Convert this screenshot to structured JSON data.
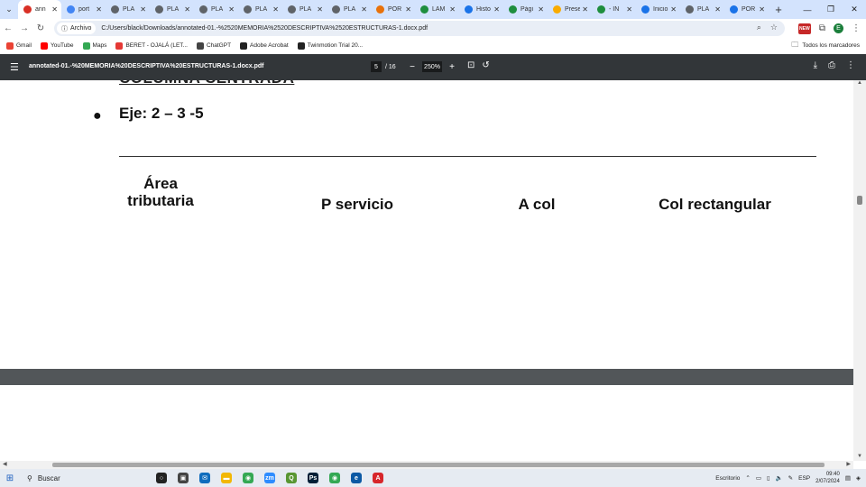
{
  "browser": {
    "tabs": [
      {
        "label": "ann",
        "active": true,
        "color": "#d93025",
        "icon": "pdf-icon"
      },
      {
        "label": "port",
        "color": "#4285f4",
        "icon": "google-icon"
      },
      {
        "label": "PLA",
        "color": "#5f6368",
        "icon": "globe-icon"
      },
      {
        "label": "PLA",
        "color": "#5f6368",
        "icon": "globe-icon"
      },
      {
        "label": "PLA",
        "color": "#5f6368",
        "icon": "globe-icon"
      },
      {
        "label": "PLA",
        "color": "#5f6368",
        "icon": "globe-icon"
      },
      {
        "label": "PLA",
        "color": "#5f6368",
        "icon": "globe-icon"
      },
      {
        "label": "PLA",
        "color": "#5f6368",
        "icon": "globe-icon"
      },
      {
        "label": "POR",
        "color": "#e8710a",
        "icon": "pdf-icon"
      },
      {
        "label": "LAM",
        "color": "#1e8e3e",
        "icon": "drive-icon"
      },
      {
        "label": "Histo",
        "color": "#1a73e8",
        "icon": "download-icon"
      },
      {
        "label": "Pági",
        "color": "#1e8e3e",
        "icon": "drive-icon"
      },
      {
        "label": "Prese",
        "color": "#f9ab00",
        "icon": "slides-icon"
      },
      {
        "label": "- IN",
        "color": "#1e8e3e",
        "icon": "drive-icon"
      },
      {
        "label": "Inicio",
        "color": "#1a73e8",
        "icon": "c-icon"
      },
      {
        "label": "PLA",
        "color": "#5f6368",
        "icon": "globe-icon"
      },
      {
        "label": "POR",
        "color": "#1a73e8",
        "icon": "doc-icon"
      }
    ],
    "new_tab": "+",
    "address": {
      "chip_label": "Archivo",
      "url": "C:/Users/black/Downloads/annotated-01.-%2520MEMORIA%2520DESCRIPTIVA%2520ESTRUCTURAS-1.docx.pdf"
    },
    "new_badge": "NEW",
    "profile_initial": "E",
    "bookmarks": [
      {
        "label": "Gmail",
        "color": "#ea4335"
      },
      {
        "label": "YouTube",
        "color": "#ff0000"
      },
      {
        "label": "Maps",
        "color": "#34a853"
      },
      {
        "label": "BERET - OJALÁ (LET...",
        "color": "#e53935"
      },
      {
        "label": "ChatGPT",
        "color": "#444444"
      },
      {
        "label": "Adobe Acrobat",
        "color": "#222222"
      },
      {
        "label": "Twinmotion Trial 20...",
        "color": "#222222"
      }
    ],
    "all_bookmarks": "Todos los marcadores"
  },
  "pdf_viewer": {
    "title": "annotated-01.-%20MEMORIA%20DESCRIPTIVA%20ESTRUCTURAS-1.docx.pdf",
    "current_page": "5",
    "total_pages": "/ 16",
    "zoom": "250%"
  },
  "document": {
    "cut_heading": "COLUMNA CENTRADA",
    "bullet": "●",
    "eje_line": "Eje: 2 – 3 -5",
    "columns": {
      "area": "Área\ntributaria",
      "p_servicio": "P servicio",
      "a_col": "A col",
      "col_rect": "Col rectangular"
    }
  },
  "taskbar": {
    "search_placeholder": "Buscar",
    "desktop_label": "Escritorio",
    "lang": "ESP",
    "time": "09:40",
    "date": "2/07/2024",
    "apps": [
      {
        "name": "cortana",
        "color": "#222222",
        "glyph": "○"
      },
      {
        "name": "task-view",
        "color": "#444444",
        "glyph": "▣"
      },
      {
        "name": "mail",
        "color": "#0f6cbd",
        "glyph": "✉"
      },
      {
        "name": "file-explorer",
        "color": "#f2b705",
        "glyph": "▬"
      },
      {
        "name": "chrome",
        "color": "#34a853",
        "glyph": "◉"
      },
      {
        "name": "zoom",
        "color": "#2d8cff",
        "glyph": "zm"
      },
      {
        "name": "qgis",
        "color": "#589632",
        "glyph": "Q"
      },
      {
        "name": "photoshop",
        "color": "#001e36",
        "glyph": "Ps"
      },
      {
        "name": "chrome-active",
        "color": "#34a853",
        "glyph": "◉"
      },
      {
        "name": "edge",
        "color": "#0c59a4",
        "glyph": "e"
      },
      {
        "name": "acrobat",
        "color": "#d7262b",
        "glyph": "A"
      }
    ]
  }
}
